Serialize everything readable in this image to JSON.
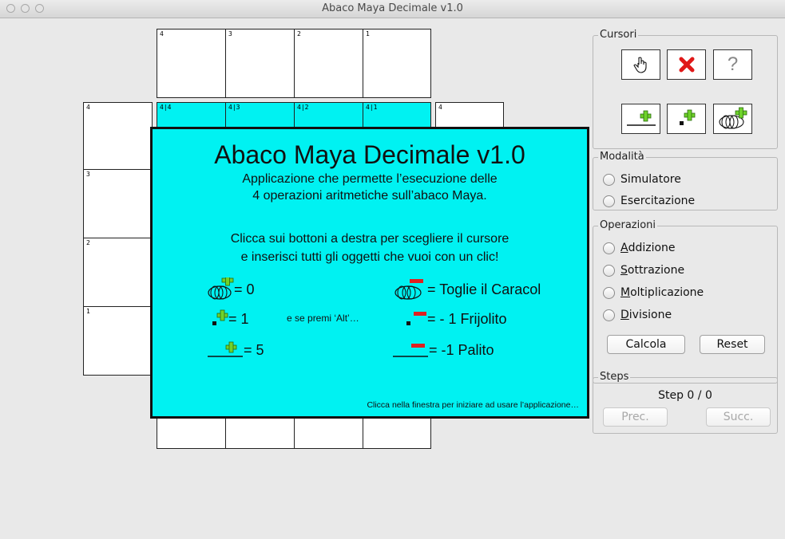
{
  "window": {
    "title": "Abaco Maya Decimale v1.0"
  },
  "grid": {
    "top_labels": [
      "4",
      "3",
      "2",
      "1"
    ],
    "row_labels": [
      "4|4",
      "4|3",
      "4|2",
      "4|1"
    ],
    "left_labels": [
      "4",
      "3",
      "2",
      "1"
    ],
    "right_label": "4"
  },
  "splash": {
    "title": "Abaco Maya Decimale v1.0",
    "line1": "Applicazione che permette l’esecuzione delle",
    "line2": "4 operazioni aritmetiche sull’abaco Maya.",
    "line3": "Clicca sui bottoni a destra per scegliere il cursore",
    "line4": "e inserisci tutti gli oggetti che vuoi con un clic!",
    "legend": {
      "caracol_eq": "= 0",
      "frijolito_eq": "= 1",
      "palito_eq": "= 5",
      "alt_hint": "e se premi ‘Alt’…",
      "remove_caracol": "= Toglie il Caracol",
      "remove_frijolito": "= - 1 Frijolito",
      "remove_palito": "= -1 Palito"
    },
    "footer": "Clicca nella finestra per iniziare ad usare l’applicazione…"
  },
  "panels": {
    "cursori": {
      "title": "Cursori",
      "buttons": [
        "hand-cursor",
        "delete-cursor",
        "help",
        "add-palito",
        "add-frijolito",
        "add-caracol"
      ],
      "help_label": "?"
    },
    "modalita": {
      "title": "Modalità",
      "options": [
        "Simulatore",
        "Esercitazione"
      ]
    },
    "operazioni": {
      "title": "Operazioni",
      "options": [
        {
          "first": "A",
          "rest": "ddizione"
        },
        {
          "first": "S",
          "rest": "ottrazione"
        },
        {
          "first": "M",
          "rest": "oltiplicazione"
        },
        {
          "first": "D",
          "rest": "ivisione"
        }
      ],
      "calcola": "Calcola",
      "reset": "Reset"
    },
    "steps": {
      "title": "Steps",
      "status": "Step 0 / 0",
      "prev": "Prec.",
      "next": "Succ."
    }
  },
  "colors": {
    "abacus_cyan": "#00f2f2",
    "plus_green": "#6fd32a",
    "minus_red": "#e02020",
    "delete_red": "#e01818"
  }
}
